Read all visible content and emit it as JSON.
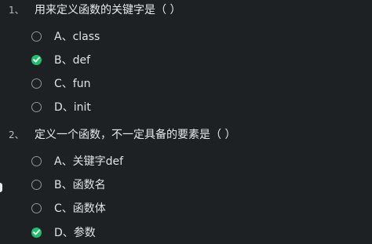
{
  "questions": [
    {
      "number": "1、",
      "text": "用来定义函数的关键字是（ ）",
      "options": [
        {
          "label": "A、class",
          "selected": false
        },
        {
          "label": "B、def",
          "selected": true
        },
        {
          "label": "C、fun",
          "selected": false
        },
        {
          "label": "D、init",
          "selected": false
        }
      ]
    },
    {
      "number": "2、",
      "text": "定义一个函数，不一定具备的要素是（ ）",
      "options": [
        {
          "label": "A、关键字def",
          "selected": false
        },
        {
          "label": "B、函数名",
          "selected": false
        },
        {
          "label": "C、函数体",
          "selected": false
        },
        {
          "label": "D、参数",
          "selected": true
        }
      ]
    }
  ],
  "colors": {
    "background": "#1e2124",
    "checked": "#1fbf6b",
    "radio_border": "#8f959b"
  },
  "icons": {
    "unchecked": "radio-unchecked-icon",
    "checked": "check-circle-icon"
  }
}
